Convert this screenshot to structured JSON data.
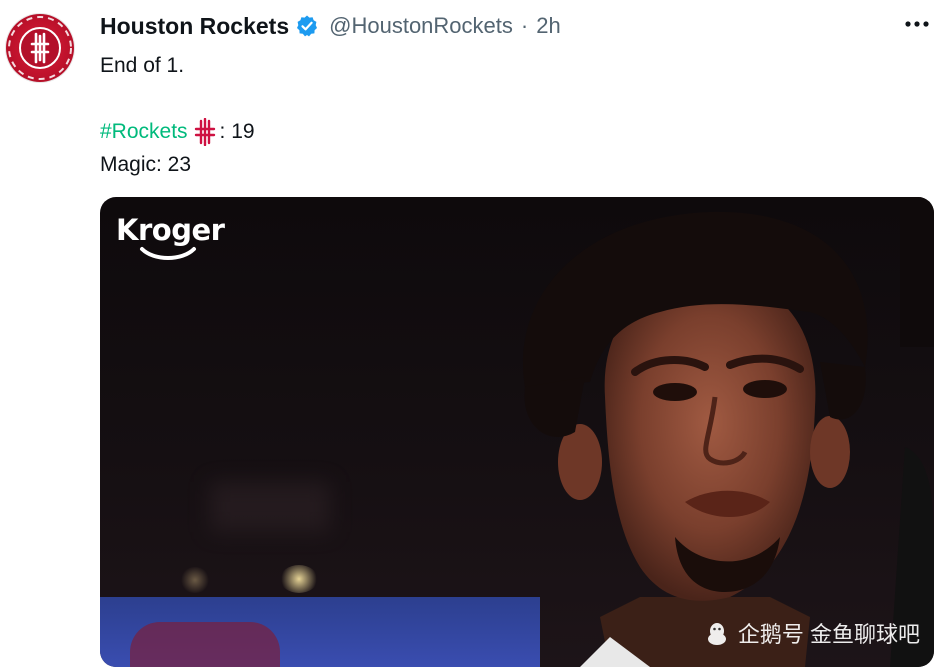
{
  "tweet": {
    "display_name": "Houston Rockets",
    "handle": "@HoustonRockets",
    "separator": "·",
    "time": "2h",
    "lines": {
      "line1": "End of 1.",
      "hashtag": "#Rockets",
      "rockets_score": ": 19",
      "line3": "Magic: 23"
    },
    "avatar_icon": "rockets-logo-icon",
    "verified_icon": "verified-badge-icon",
    "more_icon": "more-options-icon"
  },
  "media": {
    "sponsor_logo": "Kroger",
    "watermark": "企鹅号 金鱼聊球吧"
  },
  "colors": {
    "hashtag": "#00ba7c",
    "verified": "#1d9bf0",
    "avatar_red": "#c0122c",
    "secondary_text": "#536471"
  }
}
